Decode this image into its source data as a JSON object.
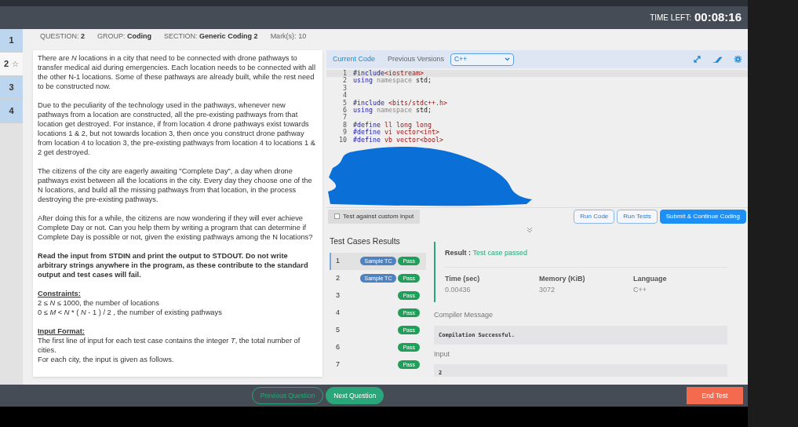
{
  "timer": {
    "label": "TIME LEFT:",
    "value": "00:08:16"
  },
  "question_nav": [
    {
      "number": "1",
      "selected": false,
      "answered": true
    },
    {
      "number": "2",
      "selected": true,
      "answered": false,
      "star": "☆"
    },
    {
      "number": "3",
      "selected": false,
      "answered": true
    },
    {
      "number": "4",
      "selected": false,
      "answered": true
    }
  ],
  "question_info": [
    {
      "label": "QUESTION:",
      "value": "2"
    },
    {
      "label": "GROUP:",
      "value": "Coding"
    },
    {
      "label": "SECTION:",
      "value": "Generic Coding 2"
    },
    {
      "label": "Mark(s):",
      "value": "10"
    }
  ],
  "problem": [
    {
      "kind": "para",
      "text": "There are *N* locations in a city that need to be connected with drone pathways to transfer medical aid during emergencies. Each location needs to be connected with all the other N-1 locations. Some of these pathways are already built, while the rest need to be constructed now."
    },
    {
      "kind": "para",
      "text": "Due to the peculiarity of the technology used in the pathways, whenever new pathways from a location are constructed, all the pre-existing pathways from that location get destroyed. For instance, if from location 4 drone pathways exist towards locations 1 & 2, but not towards location 3, then once you construct drone pathway from location 4 to location 3, the pre-existing pathways from location 4 to locations 1 & 2 get destroyed."
    },
    {
      "kind": "para",
      "text": "The citizens of the city are eagerly awaiting \"Complete Day\", a day when drone pathways exist between all the locations in the city. Every day they choose one of the N locations, and build all the missing pathways from that location, in the process destroying the pre-existing pathways."
    },
    {
      "kind": "para",
      "text": "After doing this for a while, the citizens are now wondering if they will ever achieve Complete Day or not. Can you help them by writing a program that can determine if Complete Day is possible or not, given the existing pathways among the N locations?"
    },
    {
      "kind": "bold",
      "text": "Read the input from STDIN and print the output to STDOUT. Do not write arbitrary strings anywhere in the program, as these contribute to the standard output and test cases will fail."
    },
    {
      "kind": "section",
      "heading": "Constraints:",
      "lines": [
        "2 ≤ *N* ≤ 1000, the number of locations",
        "0 ≤ *M* < *N* * ( *N* - 1 ) / 2 , the number of existing pathways"
      ]
    },
    {
      "kind": "section",
      "heading": "Input Format:",
      "lines": [
        "The first line of input for each test case contains the integer *T*, the total number of cities.",
        "For each city, the input is given as follows."
      ]
    }
  ],
  "editor": {
    "tabs": [
      {
        "label": "Current Code",
        "selected": true
      },
      {
        "label": "Previous Versions",
        "selected": false
      }
    ],
    "language": "C++",
    "lines": [
      {
        "number": "1",
        "code": [
          {
            "kind": "kw",
            "text": "#include"
          },
          {
            "kind": "str",
            "text": "<iostream>"
          }
        ]
      },
      {
        "number": "2",
        "code": [
          {
            "kind": "kw",
            "text": "using"
          },
          {
            "kind": "dim",
            "text": " namespace"
          },
          {
            "kind": "plain",
            "text": " std;"
          }
        ]
      },
      {
        "number": "3"
      },
      {
        "number": "4"
      },
      {
        "number": "5",
        "code": [
          {
            "kind": "kw",
            "text": "#include"
          },
          {
            "kind": "str",
            "text": " <bits/stdc++.h>"
          }
        ]
      },
      {
        "number": "6",
        "code": [
          {
            "kind": "kw",
            "text": "using"
          },
          {
            "kind": "dim",
            "text": " namespace"
          },
          {
            "kind": "plain",
            "text": " std;"
          }
        ]
      },
      {
        "number": "7"
      },
      {
        "number": "8",
        "code": [
          {
            "kind": "kw",
            "text": "#define"
          },
          {
            "kind": "str",
            "text": " ll long long"
          }
        ]
      },
      {
        "number": "9",
        "code": [
          {
            "kind": "kw",
            "text": "#define"
          },
          {
            "kind": "str",
            "text": " vi vector<int>"
          }
        ]
      },
      {
        "number": "10",
        "code": [
          {
            "kind": "kw",
            "text": "#define"
          },
          {
            "kind": "str",
            "text": " vb vector<bool>"
          }
        ]
      }
    ]
  },
  "custom_input": {
    "label": "Test against custom input",
    "checked": false
  },
  "actions": [
    "Run Code",
    "Run Tests",
    "Submit & Continue Coding"
  ],
  "results": {
    "title": "Test Cases Results",
    "cases": [
      {
        "number": "1",
        "sample": "Sample TC",
        "status": "Pass",
        "selected": true
      },
      {
        "number": "2",
        "sample": "Sample TC",
        "status": "Pass",
        "selected": false
      },
      {
        "number": "3",
        "status": "Pass",
        "selected": false
      },
      {
        "number": "4",
        "status": "Pass",
        "selected": false
      },
      {
        "number": "5",
        "status": "Pass",
        "selected": false
      },
      {
        "number": "6",
        "status": "Pass",
        "selected": false
      },
      {
        "number": "7",
        "status": "Pass",
        "selected": false
      }
    ],
    "result_label": "Result :",
    "result_value": "Test case passed",
    "stats": [
      {
        "label": "Time (sec)",
        "value": "0.00436"
      },
      {
        "label": "Memory (KiB)",
        "value": "3072"
      },
      {
        "label": "Language",
        "value": "C++"
      }
    ],
    "compiler_label": "Compiler Message",
    "compiler_message": "Compilation Successful.",
    "input_label": "Input",
    "input_value": "2"
  },
  "footer": {
    "previous": "Previous Question",
    "next": "Next Question",
    "end": "End Test"
  }
}
